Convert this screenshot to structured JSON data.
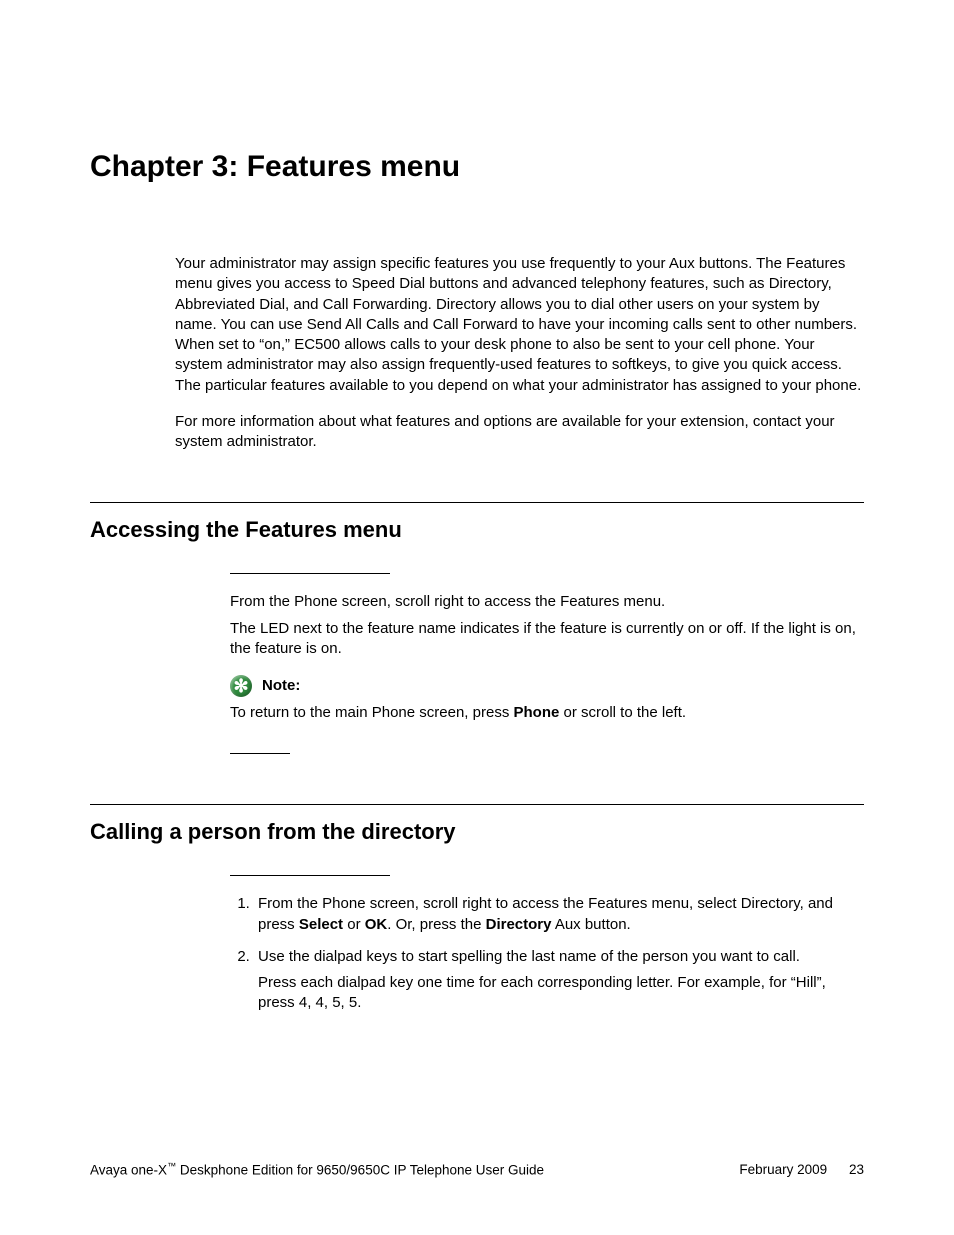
{
  "chapter": {
    "title": "Chapter 3:  Features menu"
  },
  "intro": {
    "p1": "Your administrator may assign specific features you use frequently to your Aux buttons. The Features menu gives you access to Speed Dial buttons and advanced telephony features, such as Directory, Abbreviated Dial, and Call Forwarding. Directory allows you to dial other users on your system by name. You can use Send All Calls and Call Forward to have your incoming calls sent to other numbers. When set to “on,” EC500 allows calls to your desk phone to also be sent to your cell phone. Your system administrator may also assign frequently-used features to softkeys, to give you quick access. The particular features available to you depend on what your administrator has assigned to your phone.",
    "p2": "For more information about what features and options are available for your extension, contact your system administrator."
  },
  "section1": {
    "title": "Accessing the Features menu",
    "p1": "From the Phone screen, scroll right to access the Features menu.",
    "p2": "The LED next to the feature name indicates if the feature is currently on or off. If the light is on, the feature is on.",
    "note_label": "Note:",
    "note_text_pre": "To return to the main Phone screen, press ",
    "note_bold": "Phone",
    "note_text_post": " or scroll to the left."
  },
  "section2": {
    "title": "Calling a person from the directory",
    "step1_pre": "From the Phone screen, scroll right to access the Features menu, select Directory, and press ",
    "step1_b1": "Select",
    "step1_mid": " or ",
    "step1_b2": "OK",
    "step1_mid2": ". Or, press the ",
    "step1_b3": "Directory",
    "step1_post": " Aux button.",
    "step2_a": "Use the dialpad keys to start spelling the last name of the person you want to call.",
    "step2_b": "Press each dialpad key one time for each corresponding letter. For example, for “Hill”, press 4, 4, 5, 5."
  },
  "footer": {
    "product_pre": "Avaya one-X",
    "tm": "™",
    "product_post": " Deskphone Edition for 9650/9650C IP Telephone User Guide",
    "date": "February 2009",
    "page": "23"
  }
}
